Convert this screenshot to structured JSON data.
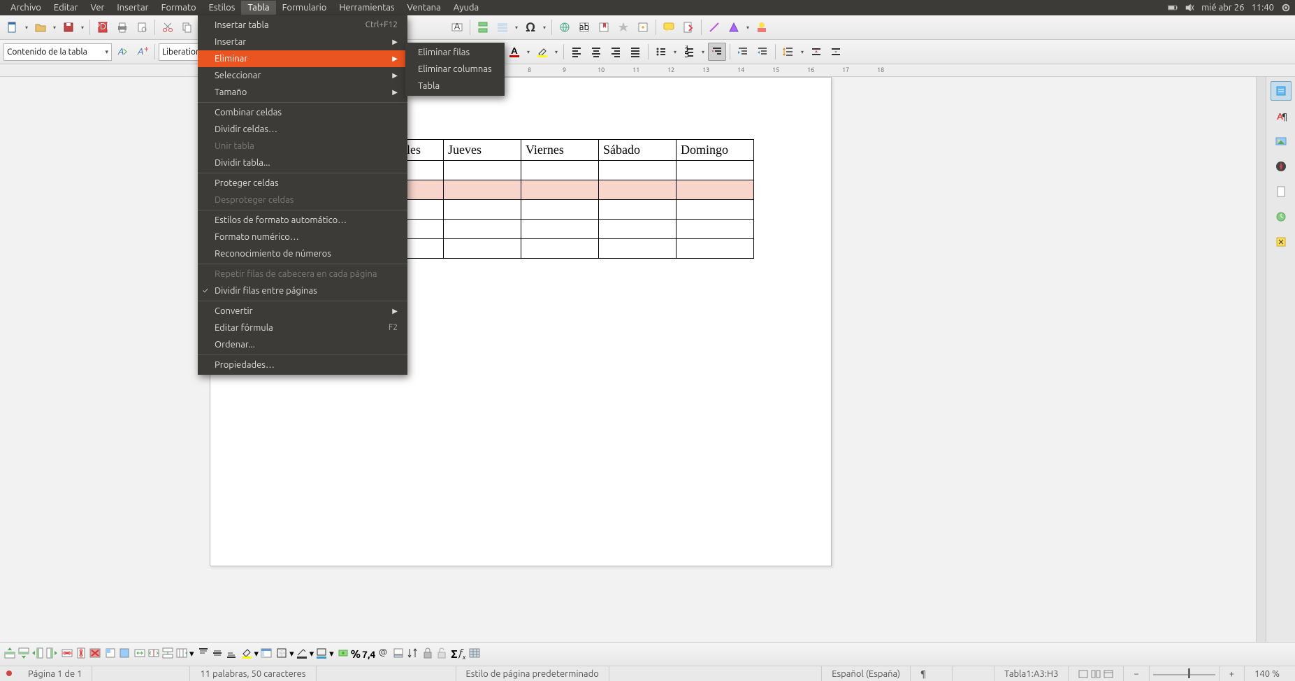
{
  "system": {
    "date": "mié abr 26",
    "time": "11:40"
  },
  "menubar": [
    "Archivo",
    "Editar",
    "Ver",
    "Insertar",
    "Formato",
    "Estilos",
    "Tabla",
    "Formulario",
    "Herramientas",
    "Ventana",
    "Ayuda"
  ],
  "active_menu_index": 6,
  "style_combo": "Contenido de la tabla",
  "font_combo": "Liberation",
  "ruler_ticks": [
    "8",
    "9",
    "10",
    "11",
    "12",
    "13",
    "14",
    "15",
    "16",
    "17",
    "18"
  ],
  "table_menu": {
    "items": [
      {
        "label": "Insertar tabla",
        "shortcut": "Ctrl+F12",
        "sub": false
      },
      {
        "label": "Insertar",
        "sub": true
      },
      {
        "label": "Eliminar",
        "sub": true,
        "highlight": true
      },
      {
        "label": "Seleccionar",
        "sub": true
      },
      {
        "label": "Tamaño",
        "sub": true
      },
      {
        "divider": true
      },
      {
        "label": "Combinar celdas"
      },
      {
        "label": "Dividir celdas…"
      },
      {
        "label": "Unir tabla",
        "disabled": true
      },
      {
        "label": "Dividir tabla..."
      },
      {
        "divider": true
      },
      {
        "label": "Proteger celdas"
      },
      {
        "label": "Desproteger celdas",
        "disabled": true
      },
      {
        "divider": true
      },
      {
        "label": "Estilos de formato automático…"
      },
      {
        "label": "Formato numérico…"
      },
      {
        "label": "Reconocimiento de números"
      },
      {
        "divider": true
      },
      {
        "label": "Repetir filas de cabecera en cada página",
        "disabled": true
      },
      {
        "label": "Dividir filas entre páginas",
        "check": true
      },
      {
        "divider": true
      },
      {
        "label": "Convertir",
        "sub": true
      },
      {
        "label": "Editar fórmula",
        "shortcut": "F2"
      },
      {
        "label": "Ordenar..."
      },
      {
        "divider": true
      },
      {
        "label": "Propiedades…"
      }
    ]
  },
  "submenu_eliminar": [
    "Eliminar filas",
    "Eliminar columnas",
    "Tabla"
  ],
  "doc_table": {
    "headers": [
      "",
      "",
      "Miércoles",
      "Jueves",
      "Viernes",
      "Sábado",
      "Domingo"
    ],
    "rows": 5,
    "selected_row": 2
  },
  "statusbar": {
    "page": "Página 1 de 1",
    "words": "11 palabras, 50 caracteres",
    "style": "Estilo de página predeterminado",
    "lang": "Español (España)",
    "insert": "",
    "sel": "Tabla1:A3:H3",
    "zoom": "140 %"
  },
  "bottom_labels": {
    "percent": "%",
    "num": "7,4"
  }
}
